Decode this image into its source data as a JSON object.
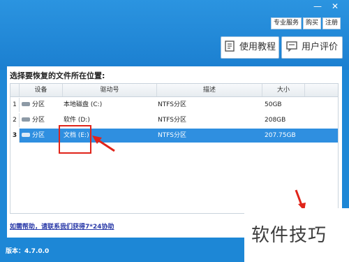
{
  "window": {
    "minimize_glyph": "—",
    "close_glyph": "✕"
  },
  "top_links": {
    "pro_service": "专业服务",
    "buy": "购买",
    "register": "注册"
  },
  "actions": {
    "tutorial": "使用教程",
    "review": "用户评价"
  },
  "panel": {
    "title": "选择要恢复的文件所在位置:"
  },
  "table": {
    "columns": [
      "设备",
      "驱动号",
      "描述",
      "大小"
    ],
    "rows": [
      {
        "index": "1",
        "device": "分区",
        "drive": "本地磁盘 (C:)",
        "desc": "NTFS分区",
        "size": "50GB",
        "selected": false
      },
      {
        "index": "2",
        "device": "分区",
        "drive": "软件 (D:)",
        "desc": "NTFS分区",
        "size": "208GB",
        "selected": false
      },
      {
        "index": "3",
        "device": "分区",
        "drive": "文档 (E:)",
        "desc": "NTFS分区",
        "size": "207.75GB",
        "selected": true
      }
    ]
  },
  "help_link": "如需帮助，请联系我们获得7*24协助",
  "version": "版本：4.7.0.0",
  "watermark": "软件技巧",
  "colors": {
    "brand_blue": "#1d87d6",
    "selected_row": "#2f8fe0",
    "annotation_red": "#e0241a"
  }
}
